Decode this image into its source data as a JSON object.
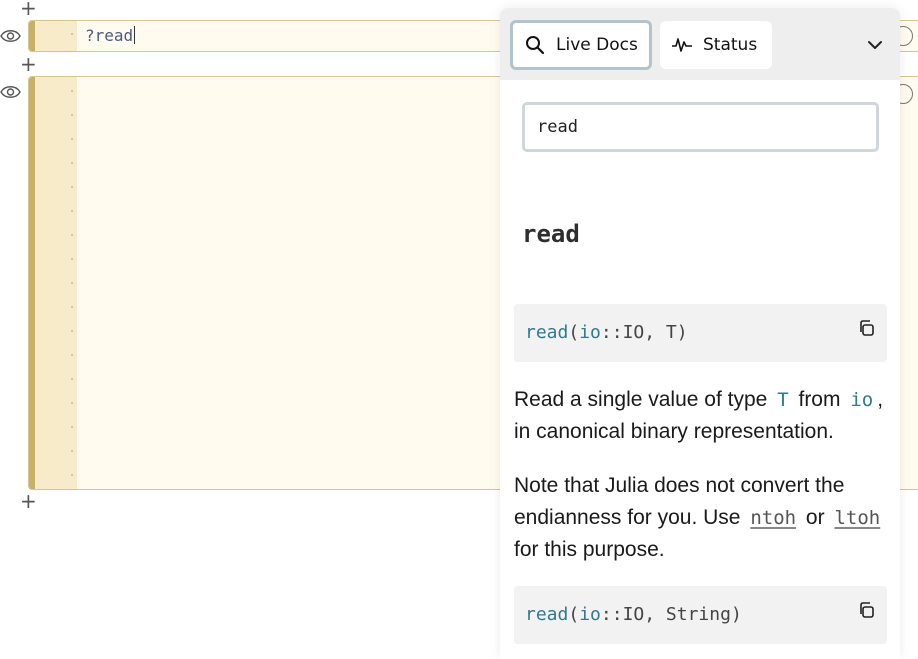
{
  "notebook": {
    "cell1": {
      "code": "?read"
    },
    "cell2": {
      "code": ""
    }
  },
  "live_docs": {
    "tabs": [
      {
        "label": "Live Docs",
        "icon": "search-icon",
        "active": true
      },
      {
        "label": "Status",
        "icon": "activity-icon",
        "active": false
      }
    ],
    "search_value": "read",
    "title": "read",
    "blocks": [
      {
        "fn": "read",
        "args_open": "(",
        "arg": "io",
        "sep": "::",
        "rest": "IO, T)"
      },
      {
        "fn": "read",
        "args_open": "(",
        "arg": "io",
        "sep": "::",
        "rest": "IO, String)"
      }
    ],
    "para1": {
      "t1": "Read a single value of type",
      "c1": "T",
      "t2": "from",
      "c2": "io",
      "t3": ", in canonical binary representation."
    },
    "para2": {
      "t1": "Note that Julia does not convert the endianness for you. Use",
      "l1": "ntoh",
      "t2": "or",
      "l2": "ltoh",
      "t3": "for this purpose."
    }
  },
  "colors": {
    "cell_bg": "#fffbee",
    "gutter": "#f7ebc9",
    "accent_bar": "#c7b06a",
    "code_fn": "#2f7a8e",
    "tab_border": "#b3c3cb"
  }
}
